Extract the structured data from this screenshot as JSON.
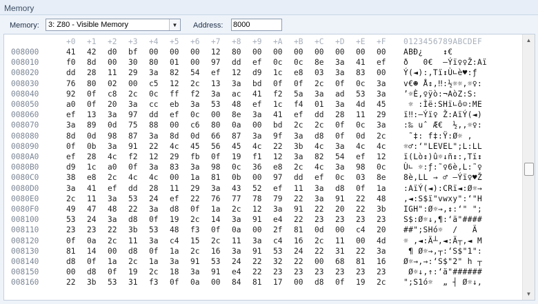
{
  "panel": {
    "title": "Memory"
  },
  "toolbar": {
    "memory_label": "Memory:",
    "memory_value": "3: Z80 - Visible Memory",
    "address_label": "Address:",
    "address_value": "8000"
  },
  "header": {
    "columns": [
      "+0",
      "+1",
      "+2",
      "+3",
      "+4",
      "+5",
      "+6",
      "+7",
      "+8",
      "+9",
      "+A",
      "+B",
      "+C",
      "+D",
      "+E",
      "+F"
    ],
    "ascii": "0123456789ABCDEF"
  },
  "rows": [
    {
      "addr": "008000",
      "bytes": [
        "41",
        "42",
        "d0",
        "bf",
        "00",
        "00",
        "00",
        "12",
        "80",
        "00",
        "00",
        "00",
        "00",
        "00",
        "00",
        "00"
      ],
      "ascii": "ABÐ¿    ↕€       "
    },
    {
      "addr": "008010",
      "bytes": [
        "f0",
        "8d",
        "00",
        "30",
        "80",
        "01",
        "00",
        "97",
        "dd",
        "ef",
        "0c",
        "0c",
        "8e",
        "3a",
        "41",
        "ef"
      ],
      "ascii": "ð   0€  —Ýï♀♀Ž:Aï"
    },
    {
      "addr": "008020",
      "bytes": [
        "dd",
        "28",
        "11",
        "29",
        "3a",
        "82",
        "54",
        "ef",
        "12",
        "d9",
        "1c",
        "e8",
        "03",
        "3a",
        "83",
        "00"
      ],
      "ascii": "Ý(◄):‚Tï↕Ù∟è♥:ƒ "
    },
    {
      "addr": "008030",
      "bytes": [
        "76",
        "80",
        "02",
        "00",
        "c5",
        "12",
        "2c",
        "13",
        "3a",
        "bd",
        "0f",
        "0f",
        "2c",
        "0f",
        "0c",
        "3a"
      ],
      "ascii": "v€☻ Å↕,‼:½☼☼,☼♀:"
    },
    {
      "addr": "008040",
      "bytes": [
        "92",
        "0f",
        "c8",
        "2c",
        "0c",
        "ff",
        "f2",
        "3a",
        "ac",
        "41",
        "f2",
        "5a",
        "3a",
        "ad",
        "53",
        "3a"
      ],
      "ascii": "’☼È,♀ÿò:¬AòZ:­S:"
    },
    {
      "addr": "008050",
      "bytes": [
        "a0",
        "0f",
        "20",
        "3a",
        "cc",
        "eb",
        "3a",
        "53",
        "48",
        "ef",
        "1c",
        "f4",
        "01",
        "3a",
        "4d",
        "45"
      ],
      "ascii": " ☼ :Ìë:SHï∟ô☺:ME"
    },
    {
      "addr": "008060",
      "bef": "",
      "bytes": [
        "ef",
        "13",
        "3a",
        "97",
        "dd",
        "ef",
        "0c",
        "00",
        "8e",
        "3a",
        "41",
        "ef",
        "dd",
        "28",
        "11",
        "29"
      ],
      "ascii": "ï‼:—Ýï♀ Ž:AïÝ(◄)"
    },
    {
      "addr": "008070",
      "bytes": [
        "3a",
        "89",
        "0d",
        "75",
        "88",
        "00",
        "c6",
        "80",
        "0a",
        "00",
        "bd",
        "2c",
        "2c",
        "0f",
        "0c",
        "3a"
      ],
      "ascii": ":‰ uˆ Æ€  ½,,☼♀:"
    },
    {
      "addr": "008080",
      "bytes": [
        "8d",
        "0d",
        "98",
        "87",
        "3a",
        "8d",
        "0d",
        "66",
        "87",
        "3a",
        "9f",
        "3a",
        "d8",
        "0f",
        "0d",
        "2c"
      ],
      "ascii": " ˜‡: f‡:Ÿ:Ø☼ ,"
    },
    {
      "addr": "008090",
      "bytes": [
        "0f",
        "0b",
        "3a",
        "91",
        "22",
        "4c",
        "45",
        "56",
        "45",
        "4c",
        "22",
        "3b",
        "4c",
        "3a",
        "4c",
        "4c"
      ],
      "ascii": "☼♂:‘\"LEVEL\";L:LL"
    },
    {
      "addr": "0080A0",
      "bytes": [
        "ef",
        "28",
        "4c",
        "f2",
        "12",
        "29",
        "fb",
        "0f",
        "19",
        "f1",
        "12",
        "3a",
        "82",
        "54",
        "ef",
        "12"
      ],
      "ascii": "ï(Lò↕)û☼↓ñ↕:‚Tï↕"
    },
    {
      "addr": "0080B0",
      "bytes": [
        "d9",
        "1c",
        "a0",
        "0f",
        "3a",
        "83",
        "3a",
        "98",
        "0c",
        "36",
        "e8",
        "2c",
        "4c",
        "3a",
        "98",
        "0c"
      ],
      "ascii": "Ù∟ ☼:ƒ:˜♀6è,L:˜♀"
    },
    {
      "addr": "0080C0",
      "bytes": [
        "38",
        "e8",
        "2c",
        "4c",
        "4c",
        "00",
        "1a",
        "81",
        "0b",
        "00",
        "97",
        "dd",
        "ef",
        "0c",
        "03",
        "8e"
      ],
      "ascii": "8è,LL → ♂ —Ýï♀♥Ž"
    },
    {
      "addr": "0080D0",
      "bytes": [
        "3a",
        "41",
        "ef",
        "dd",
        "28",
        "11",
        "29",
        "3a",
        "43",
        "52",
        "ef",
        "11",
        "3a",
        "d8",
        "0f",
        "1a"
      ],
      "ascii": ":AïÝ(◄):CRï◄:Ø☼→"
    },
    {
      "addr": "0080E0",
      "bytes": [
        "2c",
        "11",
        "3a",
        "53",
        "24",
        "ef",
        "22",
        "76",
        "77",
        "78",
        "79",
        "22",
        "3a",
        "91",
        "22",
        "48"
      ],
      "ascii": ",◄:S$ï\"vwxy\":‘\"H"
    },
    {
      "addr": "0080F0",
      "bytes": [
        "49",
        "47",
        "48",
        "22",
        "3a",
        "d8",
        "0f",
        "1a",
        "2c",
        "12",
        "3a",
        "91",
        "22",
        "20",
        "22",
        "3b"
      ],
      "ascii": "IGH\":Ø☼→,↕:‘\" \";"
    },
    {
      "addr": "008100",
      "bytes": [
        "53",
        "24",
        "3a",
        "d8",
        "0f",
        "19",
        "2c",
        "14",
        "3a",
        "91",
        "e4",
        "22",
        "23",
        "23",
        "23",
        "23"
      ],
      "ascii": "S$:Ø☼↓,¶:‘ä\"####"
    },
    {
      "addr": "008110",
      "bytes": [
        "23",
        "23",
        "22",
        "3b",
        "53",
        "48",
        "f3",
        "0f",
        "0a",
        "00",
        "2f",
        "81",
        "0d",
        "00",
        "c4",
        "20"
      ],
      "ascii": "##\";SHó☼  /   Ä "
    },
    {
      "addr": "008120",
      "bytes": [
        "0f",
        "0a",
        "2c",
        "11",
        "3a",
        "c4",
        "15",
        "2c",
        "11",
        "3a",
        "c4",
        "16",
        "2c",
        "11",
        "00",
        "4d"
      ],
      "ascii": "☼ ,◄:Ä┴,◄:Ä┬,◄ M"
    },
    {
      "addr": "008130",
      "bytes": [
        "81",
        "14",
        "00",
        "d8",
        "0f",
        "1a",
        "2c",
        "16",
        "3a",
        "91",
        "53",
        "24",
        "22",
        "31",
        "22",
        "3a"
      ],
      "ascii": " ¶ Ø☼→,┬:‘S$\"1\":"
    },
    {
      "addr": "008140",
      "bytes": [
        "d8",
        "0f",
        "1a",
        "2c",
        "1a",
        "3a",
        "91",
        "53",
        "24",
        "22",
        "32",
        "22",
        "00",
        "68",
        "81",
        "16"
      ],
      "ascii": "Ø☼→,→:‘S$\"2\" h ┬"
    },
    {
      "addr": "008150",
      "bytes": [
        "00",
        "d8",
        "0f",
        "19",
        "2c",
        "18",
        "3a",
        "91",
        "e4",
        "22",
        "23",
        "23",
        "23",
        "23",
        "23",
        "23"
      ],
      "ascii": " Ø☼↓,↑:‘ä\"######"
    },
    {
      "addr": "008160",
      "bytes": [
        "22",
        "3b",
        "53",
        "31",
        "f3",
        "0f",
        "0a",
        "00",
        "84",
        "81",
        "17",
        "00",
        "d8",
        "0f",
        "19",
        "2c"
      ],
      "ascii": "\";S1ó☼  „ ┤ Ø☼↓,"
    }
  ]
}
